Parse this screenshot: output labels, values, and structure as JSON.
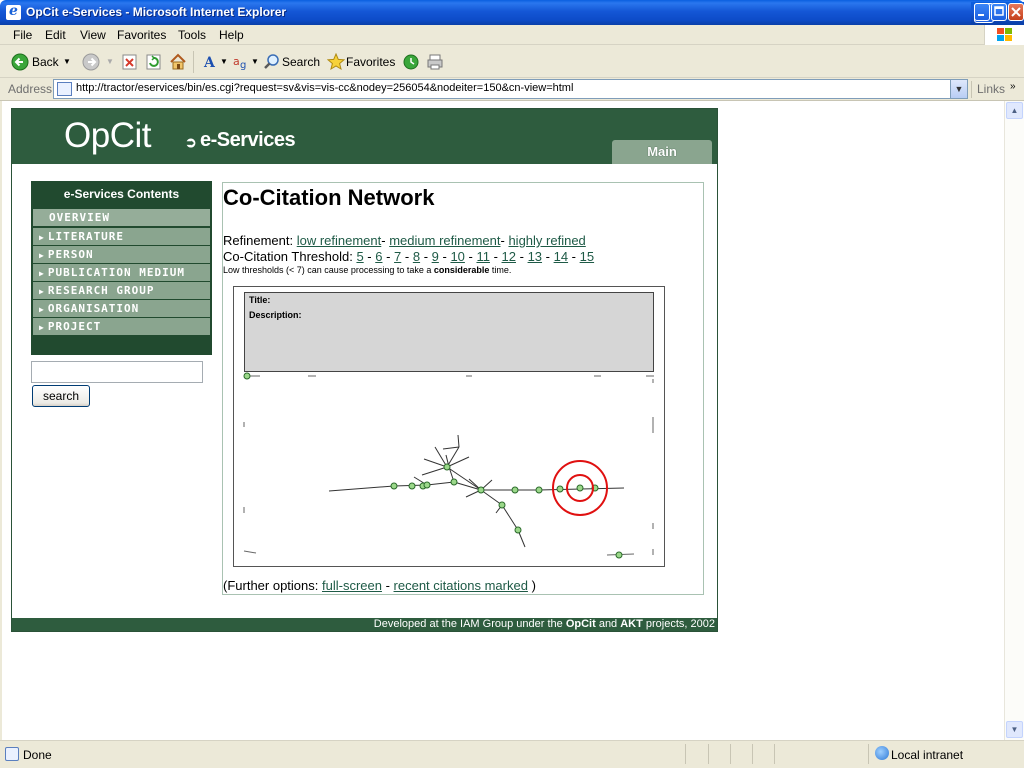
{
  "window": {
    "title": "OpCit e-Services - Microsoft Internet Explorer"
  },
  "menu": {
    "items": [
      {
        "label": "File"
      },
      {
        "label": "Edit"
      },
      {
        "label": "View"
      },
      {
        "label": "Favorites"
      },
      {
        "label": "Tools"
      },
      {
        "label": "Help"
      }
    ]
  },
  "toolbar": {
    "back_label": "Back",
    "search_label": "Search",
    "favorites_label": "Favorites"
  },
  "address": {
    "label": "Address",
    "url": "http://tractor/eservices/bin/es.cgi?request=sv&vis=vis-cc&nodey=256054&nodeiter=150&cn-view=html",
    "links_label": "Links"
  },
  "header": {
    "logo": "OpCit",
    "logo_arrow": "➲",
    "subtitle": "e-Services",
    "main_tab": "Main"
  },
  "sidebar": {
    "heading": "e-Services Contents",
    "items": [
      {
        "label": "OVERVIEW"
      },
      {
        "label": "LITERATURE"
      },
      {
        "label": "PERSON"
      },
      {
        "label": "PUBLICATION MEDIUM"
      },
      {
        "label": "RESEARCH GROUP"
      },
      {
        "label": "ORGANISATION"
      },
      {
        "label": "PROJECT"
      }
    ],
    "search_value": "",
    "search_button": "search"
  },
  "content": {
    "title": "Co-Citation Network",
    "refinement_label": "Refinement:",
    "refinement_links": [
      "low refinement",
      "medium refinement",
      "highly refined"
    ],
    "threshold_label": "Co-Citation Threshold:",
    "thresholds": [
      "5",
      "6",
      "7",
      "8",
      "9",
      "10",
      "11",
      "12",
      "13",
      "14",
      "15"
    ],
    "note_pre": "Low thresholds (< 7) can cause processing to take a ",
    "note_bold": "considerable",
    "note_post": " time.",
    "info_title": "Title:",
    "info_description": "Description:",
    "further_pre": "(Further options:",
    "further_links": [
      "full-screen",
      "recent citations marked"
    ],
    "further_post": ")"
  },
  "footer": {
    "pre": "Developed at the IAM Group under the ",
    "opcit": "OpCit",
    "and": " and ",
    "akt": "AKT",
    "post": " projects, 2002"
  },
  "status": {
    "text": "Done",
    "zone": "Local intranet"
  }
}
